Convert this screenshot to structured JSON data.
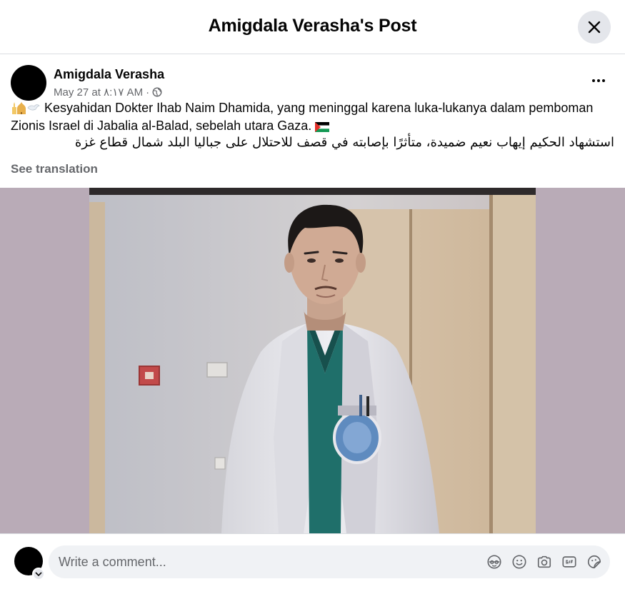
{
  "modal": {
    "title": "Amigdala Verasha's Post",
    "close_icon": "close-icon"
  },
  "post": {
    "author": "Amigdala Verasha",
    "date": "May 27 at ٨:١٧ AM",
    "separator": "·",
    "audience_icon": "globe-icon",
    "more_icon": "more-options-icon",
    "text_id": "Kesyahidan Dokter Ihab Naim Dhamida, yang meninggal karena luka-lukanya dalam pemboman Zionis Israel di Jabalia al-Balad, sebelah utara Gaza.",
    "text_ar": "استشهاد الحكيم إيهاب نعيم ضميدة، متأثرًا بإصابته في قصف للاحتلال على جباليا البلد شمال قطاع غزة",
    "see_translation": "See translation",
    "leading_emoji": "mosque-dove-emoji",
    "trailing_emoji": "palestine-flag-emoji"
  },
  "comment": {
    "placeholder": "Write a comment...",
    "icons": [
      "avatar-sticker-icon",
      "emoji-icon",
      "camera-icon",
      "gif-icon",
      "sticker-icon"
    ]
  },
  "colors": {
    "secondary_text": "#65676b",
    "comment_bg": "#f0f2f5",
    "close_bg": "#e4e6eb",
    "photo_backdrop": "#b9abb7"
  }
}
